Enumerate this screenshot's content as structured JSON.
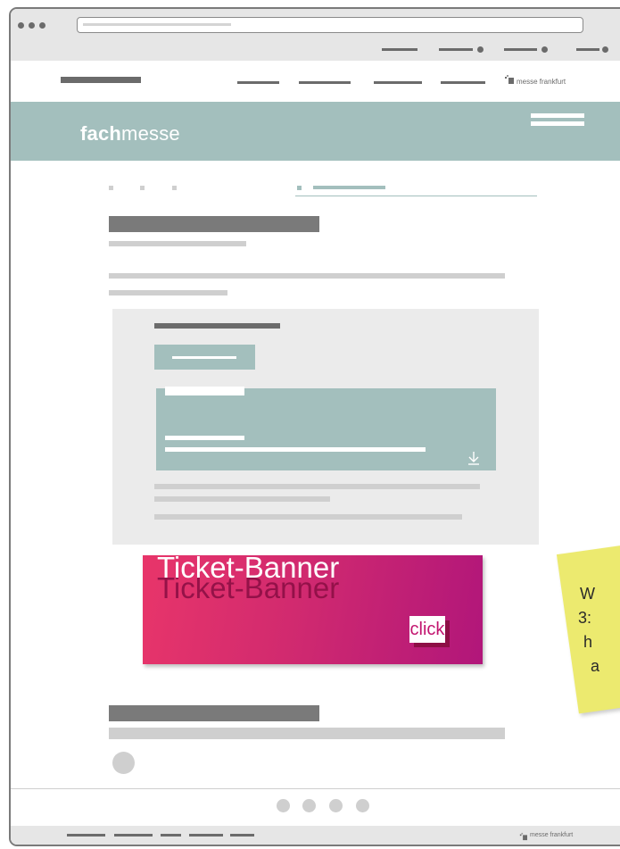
{
  "logo": {
    "brand_bold": "fach",
    "brand_light": "messe"
  },
  "header": {
    "partner_logo": "messe frankfurt"
  },
  "banner": {
    "title": "Ticket-Banner",
    "shadow_title": "Ticket-Banner",
    "button_label": "click"
  },
  "sticky_note": {
    "lines": [
      "W",
      "3:",
      "h",
      "a"
    ]
  },
  "footer": {
    "partner_logo": "messe frankfurt"
  },
  "icons": {
    "download": "download-icon",
    "menu": "hamburger-menu-icon",
    "partner": "messe-frankfurt-logo-icon"
  },
  "colors": {
    "teal": "#a3bfbd",
    "banner_start": "#e8356a",
    "banner_end": "#b1167a",
    "sticky": "#ecea6f"
  }
}
